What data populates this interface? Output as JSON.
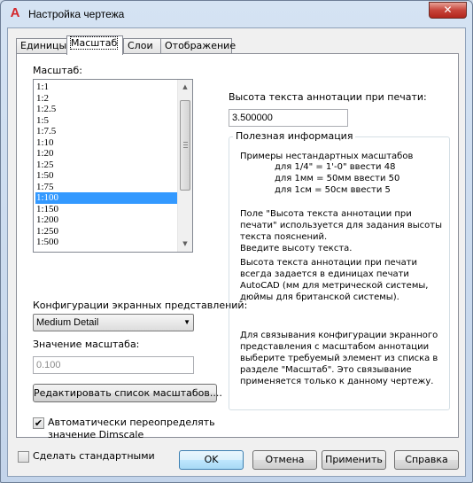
{
  "window": {
    "title": "Настройка чертежа",
    "close_glyph": "✕",
    "app_icon_glyph": "A"
  },
  "tabs": [
    "Единицы",
    "Масштаб",
    "Слои",
    "Отображение"
  ],
  "active_tab": "Масштаб",
  "scale_list": {
    "label": "Масштаб:",
    "items": [
      "1:1",
      "1:2",
      "1:2.5",
      "1:5",
      "1:7.5",
      "1:10",
      "1:20",
      "1:25",
      "1:50",
      "1:75",
      "1:100",
      "1:150",
      "1:200",
      "1:250",
      "1:500"
    ],
    "selected": "1:100"
  },
  "viewport_config": {
    "label": "Конфигурации экранных представлений:",
    "value": "Medium Detail"
  },
  "scale_value": {
    "label": "Значение масштаба:",
    "value": "0.100"
  },
  "edit_scales_button": "Редактировать список масштабов....",
  "auto_override": {
    "label_line1": "Автоматически переопределять",
    "label_line2": "значение Dimscale",
    "checked": true
  },
  "annotation_height": {
    "label": "Высота текста аннотации при печати:",
    "value": "3.500000"
  },
  "info": {
    "title": "Полезная информация",
    "examples_title": "Примеры нестандартных масштабов",
    "examples": [
      "для 1/4\" = 1'-0\" ввести 48",
      "для 1мм = 50мм ввести 50",
      "для 1см = 50см ввести 5"
    ],
    "para1": [
      "Поле \"Высота текста аннотации при",
      "печати\" используется для задания высоты",
      "текста пояснений.",
      "Введите высоту текста."
    ],
    "para2": [
      "Высота текста аннотации при печати",
      "всегда задается в единицах печати",
      "AutoCAD (мм для метрической системы,",
      "дюймы для британской системы)."
    ],
    "para3": [
      "Для связывания конфигурации экранного",
      "представления с масштабом аннотации",
      "выберите требуемый элемент из списка в",
      "разделе \"Масштаб\". Это связывание",
      "применяется только к данному чертежу."
    ]
  },
  "make_default": {
    "label": "Сделать стандартными",
    "checked": false
  },
  "buttons": {
    "ok": "OK",
    "cancel": "Отмена",
    "apply": "Применить",
    "help": "Справка"
  }
}
